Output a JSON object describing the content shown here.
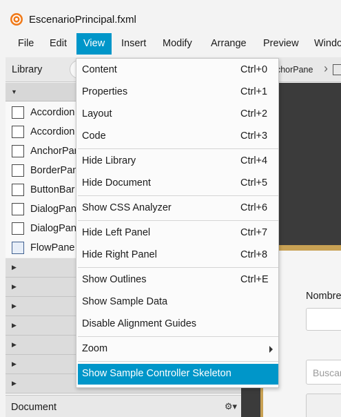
{
  "window": {
    "title": "EscenarioPrincipal.fxml"
  },
  "colors": {
    "accent": "#0096c9",
    "stage_border": "#c8a154",
    "canvas": "#3b3b3b"
  },
  "menubar": {
    "items": [
      {
        "label": "File"
      },
      {
        "label": "Edit"
      },
      {
        "label": "View"
      },
      {
        "label": "Insert"
      },
      {
        "label": "Modify"
      },
      {
        "label": "Arrange"
      },
      {
        "label": "Preview"
      },
      {
        "label": "Windo"
      }
    ]
  },
  "library": {
    "label": "Library",
    "items": [
      {
        "label": "Accordion",
        "icon": "accordion-icon"
      },
      {
        "label": "Accordion",
        "icon": "accordion-icon"
      },
      {
        "label": "AnchorPar",
        "icon": "anchor-pane-icon"
      },
      {
        "label": "BorderPan",
        "icon": "border-pane-icon"
      },
      {
        "label": "ButtonBar",
        "icon": "button-bar-icon"
      },
      {
        "label": "DialogPan",
        "icon": "dialog-pane-icon"
      },
      {
        "label": "DialogPan",
        "icon": "dialog-pane-icon"
      },
      {
        "label": "FlowPane",
        "icon": "flow-pane-icon"
      }
    ]
  },
  "document": {
    "label": "Document"
  },
  "breadcrumb": {
    "label": "nchorPane"
  },
  "form": {
    "name_label": "Nombre",
    "search_placeholder": "Buscar"
  },
  "view_menu": {
    "items": [
      {
        "label": "Content",
        "accel": "Ctrl+0"
      },
      {
        "label": "Properties",
        "accel": "Ctrl+1"
      },
      {
        "label": "Layout",
        "accel": "Ctrl+2"
      },
      {
        "label": "Code",
        "accel": "Ctrl+3"
      },
      {
        "label": "Hide Library",
        "accel": "Ctrl+4"
      },
      {
        "label": "Hide Document",
        "accel": "Ctrl+5"
      },
      {
        "label": "Show CSS Analyzer",
        "accel": "Ctrl+6"
      },
      {
        "label": "Hide Left Panel",
        "accel": "Ctrl+7"
      },
      {
        "label": "Hide Right Panel",
        "accel": "Ctrl+8"
      },
      {
        "label": "Show Outlines",
        "accel": "Ctrl+E"
      },
      {
        "label": "Show Sample Data",
        "accel": ""
      },
      {
        "label": "Disable Alignment Guides",
        "accel": ""
      },
      {
        "label": "Zoom",
        "accel": ""
      },
      {
        "label": "Show Sample Controller Skeleton",
        "accel": ""
      }
    ]
  }
}
